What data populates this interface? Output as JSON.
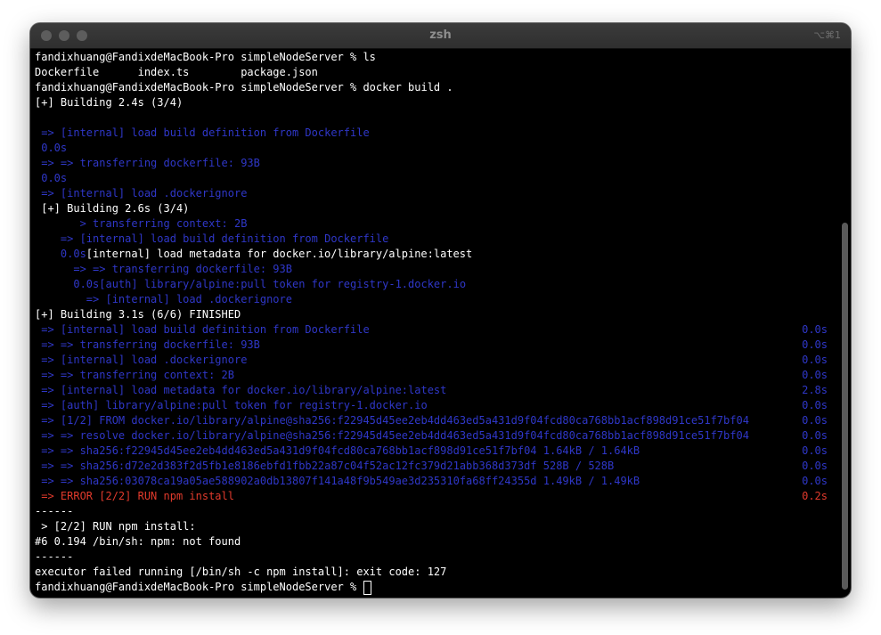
{
  "window": {
    "title": "zsh",
    "shortcut": "⌥⌘1"
  },
  "terminal": {
    "lines": [
      {
        "text": "fandixhuang@FandixdeMacBook-Pro simpleNodeServer % ls",
        "right": "",
        "color": "white"
      },
      {
        "text": "Dockerfile      index.ts        package.json",
        "right": "",
        "color": "white"
      },
      {
        "text": "fandixhuang@FandixdeMacBook-Pro simpleNodeServer % docker build .",
        "right": "",
        "color": "white"
      },
      {
        "text": "[+] Building 2.4s (3/4)",
        "right": "",
        "color": "white"
      },
      {
        "text": "",
        "right": "",
        "color": "white"
      },
      {
        "text": " => [internal] load build definition from Dockerfile",
        "right": "",
        "color": "blue"
      },
      {
        "text": " 0.0s",
        "right": "",
        "color": "blue"
      },
      {
        "text": " => => transferring dockerfile: 93B",
        "right": "",
        "color": "blue"
      },
      {
        "text": " 0.0s",
        "right": "",
        "color": "blue"
      },
      {
        "text": " => [internal] load .dockerignore",
        "right": "",
        "color": "blue"
      },
      {
        "text": " [+] Building 2.6s (3/4)",
        "right": "",
        "color": "white"
      },
      {
        "text": "       > transferring context: 2B",
        "right": "",
        "color": "blue"
      },
      {
        "text": "    => [internal] load build definition from Dockerfile",
        "right": "",
        "color": "blue"
      },
      {
        "text": "    0.0s",
        "text2": "[internal] load metadata for docker.io/library/alpine:latest",
        "right": "",
        "color": "blue"
      },
      {
        "text": "      => => transferring dockerfile: 93B",
        "right": "",
        "color": "blue"
      },
      {
        "text": "      0.0s[auth] library/alpine:pull token for registry-1.docker.io",
        "right": "",
        "color": "blue"
      },
      {
        "text": "        => [internal] load .dockerignore",
        "right": "",
        "color": "blue"
      },
      {
        "text": "[+] Building 3.1s (6/6) FINISHED",
        "right": "",
        "color": "white"
      },
      {
        "text": " => [internal] load build definition from Dockerfile",
        "right": "0.0s",
        "color": "blue"
      },
      {
        "text": " => => transferring dockerfile: 93B",
        "right": "0.0s",
        "color": "blue"
      },
      {
        "text": " => [internal] load .dockerignore",
        "right": "0.0s",
        "color": "blue"
      },
      {
        "text": " => => transferring context: 2B",
        "right": "0.0s",
        "color": "blue"
      },
      {
        "text": " => [internal] load metadata for docker.io/library/alpine:latest",
        "right": "2.8s",
        "color": "blue"
      },
      {
        "text": " => [auth] library/alpine:pull token for registry-1.docker.io",
        "right": "0.0s",
        "color": "blue"
      },
      {
        "text": " => [1/2] FROM docker.io/library/alpine@sha256:f22945d45ee2eb4dd463ed5a431d9f04fcd80ca768bb1acf898d91ce51f7bf04",
        "right": "0.0s",
        "color": "blue"
      },
      {
        "text": " => => resolve docker.io/library/alpine@sha256:f22945d45ee2eb4dd463ed5a431d9f04fcd80ca768bb1acf898d91ce51f7bf04",
        "right": "0.0s",
        "color": "blue"
      },
      {
        "text": " => => sha256:f22945d45ee2eb4dd463ed5a431d9f04fcd80ca768bb1acf898d91ce51f7bf04 1.64kB / 1.64kB",
        "right": "0.0s",
        "color": "blue"
      },
      {
        "text": " => => sha256:d72e2d383f2d5fb1e8186ebfd1fbb22a87c04f52ac12fc379d21abb368d373df 528B / 528B",
        "right": "0.0s",
        "color": "blue"
      },
      {
        "text": " => => sha256:03078ca19a05ae588902a0db13807f141a48f9b549ae3d235310fa68ff24355d 1.49kB / 1.49kB",
        "right": "0.0s",
        "color": "blue"
      },
      {
        "text": " => ERROR [2/2] RUN npm install",
        "right": "0.2s",
        "color": "red"
      },
      {
        "text": "------",
        "right": "",
        "color": "white"
      },
      {
        "text": " > [2/2] RUN npm install:",
        "right": "",
        "color": "white"
      },
      {
        "text": "#6 0.194 /bin/sh: npm: not found",
        "right": "",
        "color": "white"
      },
      {
        "text": "------",
        "right": "",
        "color": "white"
      },
      {
        "text": "executor failed running [/bin/sh -c npm install]: exit code: 127",
        "right": "",
        "color": "white"
      },
      {
        "text": "fandixhuang@FandixdeMacBook-Pro simpleNodeServer % ",
        "right": "",
        "color": "white",
        "cursor": true
      }
    ]
  },
  "colors": {
    "background": "#000000",
    "text": "#ffffff",
    "blue": "#2f37c8",
    "red": "#e13a2c"
  }
}
